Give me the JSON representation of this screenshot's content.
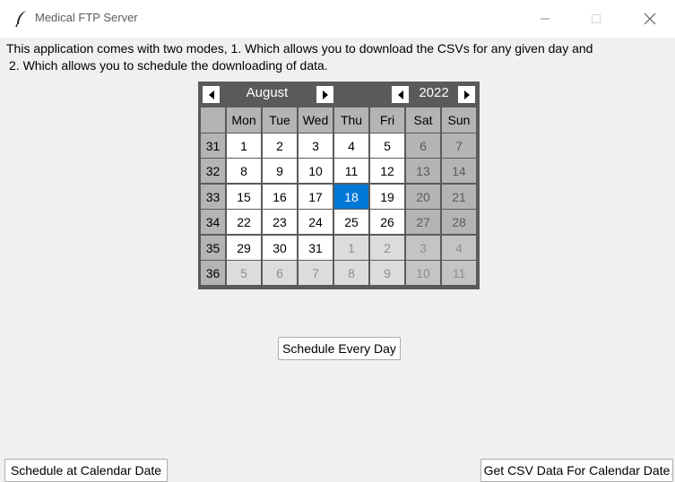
{
  "window": {
    "title": "Medical FTP Server",
    "icon": "feather-icon",
    "controls": [
      "minimize-icon",
      "maximize-icon",
      "close-icon"
    ]
  },
  "description": {
    "line1": "This application comes with two modes, 1. Which allows you to download the CSVs for any given day and",
    "line2": "2. Which allows you to schedule the downloading of data."
  },
  "calendar": {
    "month": "August",
    "year": "2022",
    "weekdays": [
      "Mon",
      "Tue",
      "Wed",
      "Thu",
      "Fri",
      "Sat",
      "Sun"
    ],
    "weeks": [
      {
        "num": "31",
        "days": [
          "1",
          "2",
          "3",
          "4",
          "5",
          "6",
          "7"
        ]
      },
      {
        "num": "32",
        "days": [
          "8",
          "9",
          "10",
          "11",
          "12",
          "13",
          "14"
        ]
      },
      {
        "num": "33",
        "days": [
          "15",
          "16",
          "17",
          "18",
          "19",
          "20",
          "21"
        ]
      },
      {
        "num": "34",
        "days": [
          "22",
          "23",
          "24",
          "25",
          "26",
          "27",
          "28"
        ]
      },
      {
        "num": "35",
        "days": [
          "29",
          "30",
          "31",
          "1",
          "2",
          "3",
          "4"
        ]
      },
      {
        "num": "36",
        "days": [
          "5",
          "6",
          "7",
          "8",
          "9",
          "10",
          "11"
        ]
      }
    ],
    "selected_day": "18",
    "colors": {
      "selected": "#0078d7",
      "header": "#5a5a5a",
      "weekend": "#b4b4b4"
    }
  },
  "buttons": {
    "schedule_every_day": "Schedule Every Day",
    "schedule_at_date": "Schedule at Calendar Date",
    "get_csv": "Get CSV Data For Calendar Date"
  }
}
